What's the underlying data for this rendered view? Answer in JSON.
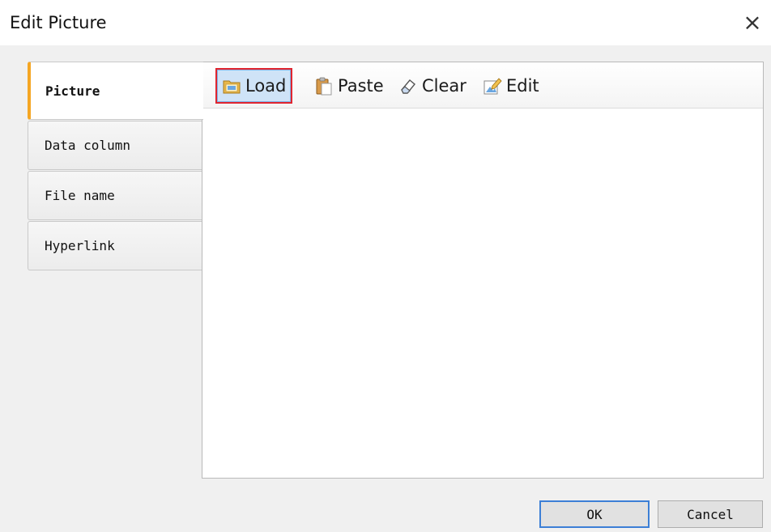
{
  "window": {
    "title": "Edit Picture",
    "close_glyph": "×"
  },
  "tabs": [
    {
      "label": "Picture",
      "active": true
    },
    {
      "label": "Data column",
      "active": false
    },
    {
      "label": "File name",
      "active": false
    },
    {
      "label": "Hyperlink",
      "active": false
    }
  ],
  "toolbar": {
    "load_label": "Load",
    "paste_label": "Paste",
    "clear_label": "Clear",
    "edit_label": "Edit",
    "highlighted": "Load",
    "icons": {
      "load": "folder-icon",
      "paste": "clipboard-icon",
      "clear": "eraser-icon",
      "edit": "edit-picture-icon"
    }
  },
  "buttons": {
    "ok_label": "OK",
    "cancel_label": "Cancel"
  },
  "colors": {
    "active_tab_accent": "#f5a623",
    "highlight_border": "#e0252f",
    "default_button_border": "#3c7fd6"
  }
}
